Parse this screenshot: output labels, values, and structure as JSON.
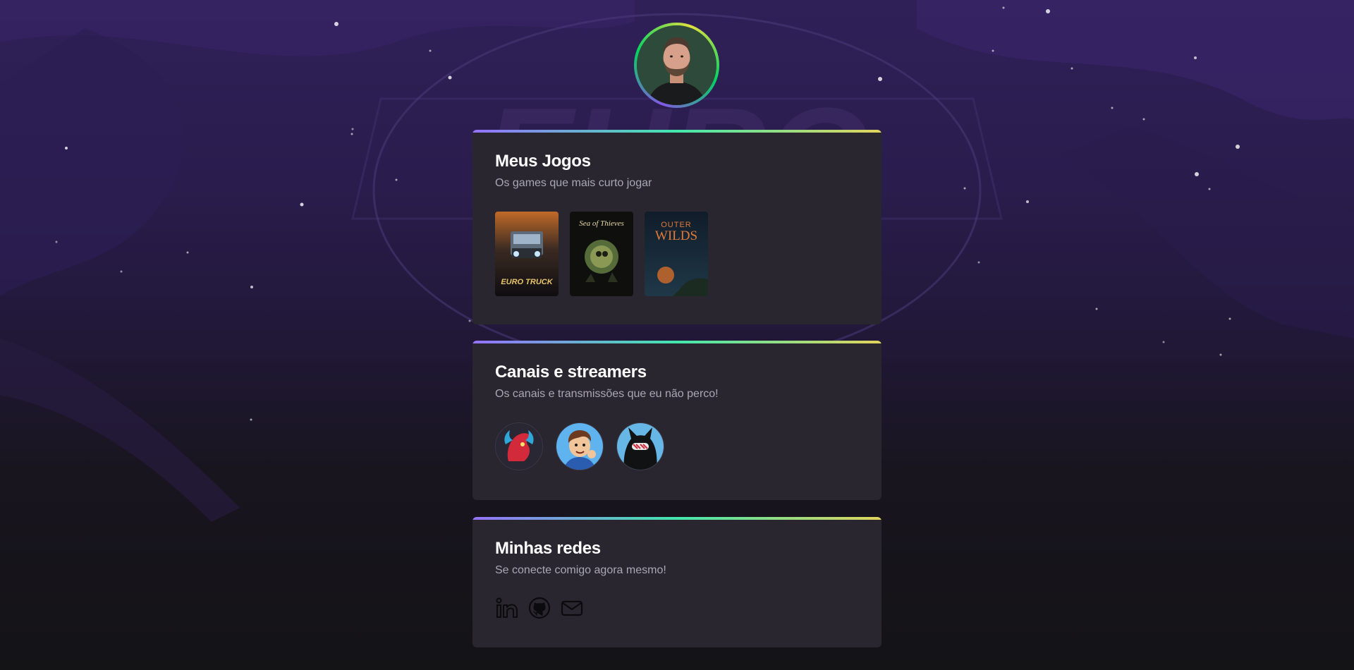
{
  "profile": {
    "avatar_alt": "avatar"
  },
  "games_card": {
    "title": "Meus Jogos",
    "subtitle": "Os games que mais curto jogar",
    "games": [
      {
        "icon": "euro-truck-simulator-cover",
        "cover_text": "EURO TRUCK"
      },
      {
        "icon": "sea-of-thieves-cover",
        "cover_text": "Sea of Thieves"
      },
      {
        "icon": "outer-wilds-cover",
        "cover_text_1": "OUTER",
        "cover_text_2": "WILDS"
      }
    ]
  },
  "channels_card": {
    "title": "Canais e streamers",
    "subtitle": "Os canais e transmissões que eu não perco!",
    "channels": [
      {
        "icon": "red-dragon-avatar"
      },
      {
        "icon": "cartoon-boy-avatar"
      },
      {
        "icon": "black-cat-avatar"
      }
    ]
  },
  "socials_card": {
    "title": "Minhas redes",
    "subtitle": "Se conecte comigo agora mesmo!",
    "links": [
      {
        "icon": "linkedin-icon"
      },
      {
        "icon": "github-icon"
      },
      {
        "icon": "email-icon"
      }
    ]
  },
  "colors": {
    "gradient_start": "#9572fc",
    "gradient_mid": "#43e7ad",
    "gradient_end": "#e2d45c",
    "card_bg": "#29262f",
    "title": "#ffffff",
    "subtitle": "#a8a8b3"
  }
}
